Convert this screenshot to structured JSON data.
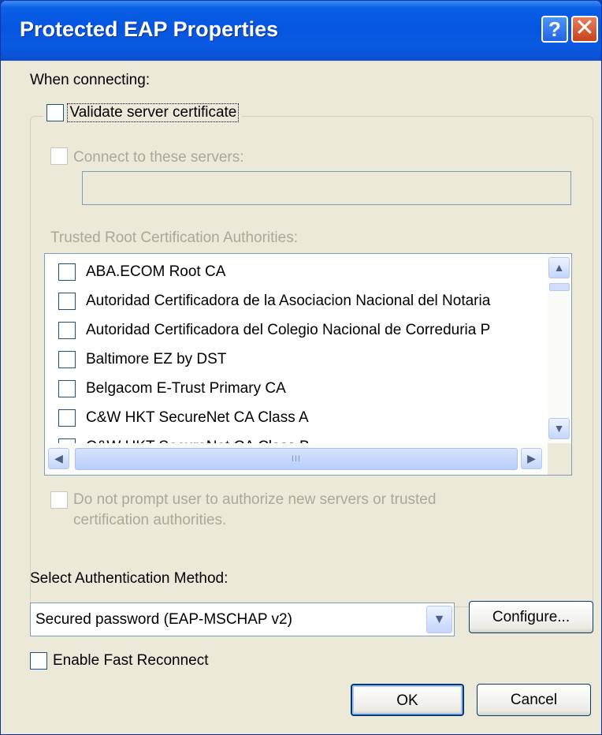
{
  "window": {
    "title": "Protected EAP Properties",
    "help_glyph": "?",
    "close_glyph": "✕"
  },
  "when_connecting_label": "When connecting:",
  "validate_cert": {
    "label": "Validate server certificate",
    "checked": false
  },
  "connect_servers": {
    "label": "Connect to these servers:",
    "checked": false,
    "value": ""
  },
  "trusted_root_label": "Trusted Root Certification Authorities:",
  "trusted_roots": [
    {
      "name": "ABA.ECOM Root CA",
      "checked": false
    },
    {
      "name": "Autoridad Certificadora de la Asociacion Nacional del Notaria",
      "checked": false
    },
    {
      "name": "Autoridad Certificadora del Colegio Nacional de Correduria P",
      "checked": false
    },
    {
      "name": "Baltimore EZ by DST",
      "checked": false
    },
    {
      "name": "Belgacom E-Trust Primary CA",
      "checked": false
    },
    {
      "name": "C&W HKT SecureNet CA Class A",
      "checked": false
    },
    {
      "name": "C&W HKT SecureNet CA Class B",
      "checked": false
    }
  ],
  "scroll_glyphs": {
    "up": "▲",
    "down": "▼",
    "left": "◀",
    "right": "▶",
    "grip": "III"
  },
  "no_prompt": {
    "line1": "Do not prompt user to authorize new servers or trusted",
    "line2": "certification authorities.",
    "checked": false
  },
  "auth_method_label": "Select Authentication Method:",
  "auth_method": {
    "selected": "Secured password (EAP-MSCHAP v2)",
    "arrow": "▼"
  },
  "configure_label": "Configure...",
  "fast_reconnect": {
    "label": "Enable Fast Reconnect",
    "checked": false
  },
  "ok_label": "OK",
  "cancel_label": "Cancel",
  "colors": {
    "titlebar": "#0555e0",
    "face": "#ece9d8",
    "disabled_text": "#aca899"
  }
}
